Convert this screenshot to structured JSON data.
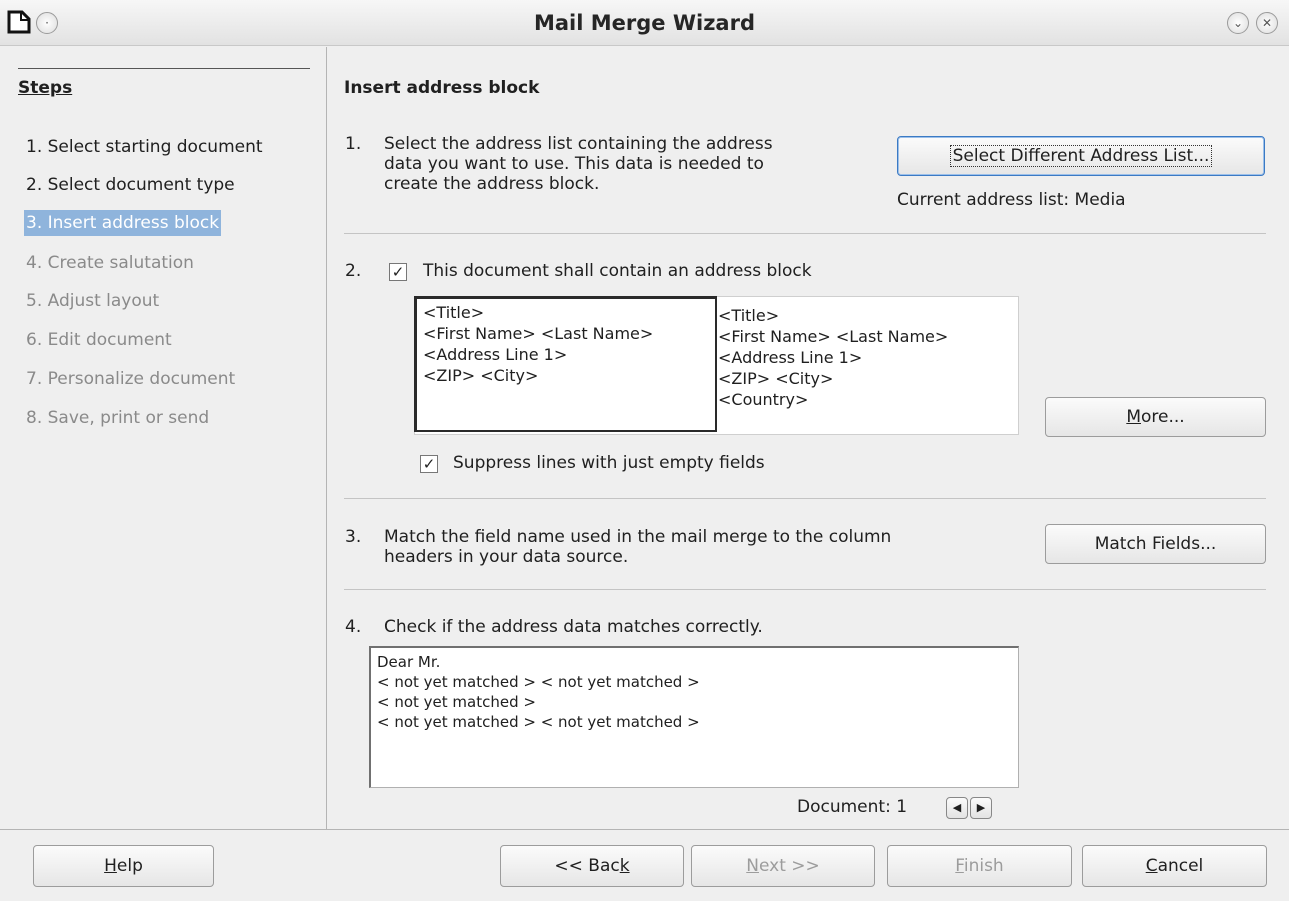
{
  "window": {
    "title": "Mail Merge Wizard"
  },
  "steps": {
    "heading": "Steps",
    "items": [
      {
        "label": "1. Select starting document",
        "state": "enabled"
      },
      {
        "label": "2. Select document type",
        "state": "enabled"
      },
      {
        "label": "3. Insert address block",
        "state": "current"
      },
      {
        "label": "4. Create salutation",
        "state": "disabled"
      },
      {
        "label": "5. Adjust layout",
        "state": "disabled"
      },
      {
        "label": "6. Edit document",
        "state": "disabled"
      },
      {
        "label": "7. Personalize document",
        "state": "disabled"
      },
      {
        "label": "8. Save, print or send",
        "state": "disabled"
      }
    ]
  },
  "main": {
    "heading": "Insert address block",
    "section1": {
      "number": "1.",
      "text_lines": [
        "Select the address list containing the address",
        "data you want to use. This data is needed to",
        "create the address block."
      ],
      "button_label": "Select Different Address List...",
      "current_list": "Current address list: Media"
    },
    "section2": {
      "number": "2.",
      "checkbox_label": "This document shall contain an address block",
      "checkbox_checked": true,
      "block1_lines": [
        "<Title>",
        "<First Name> <Last Name>",
        "<Address Line 1>",
        "<ZIP> <City>"
      ],
      "block2_lines": [
        "<Title>",
        "<First Name> <Last Name>",
        "<Address Line 1>",
        "<ZIP> <City>",
        "<Country>"
      ],
      "more_button": "More...",
      "suppress_label": "Suppress lines with just empty fields",
      "suppress_checked": true
    },
    "section3": {
      "number": "3.",
      "text_lines": [
        "Match the field name used in the mail merge to the column",
        "headers in your data source."
      ],
      "button_label": "Match Fields..."
    },
    "section4": {
      "number": "4.",
      "text": "Check if the address data matches correctly.",
      "preview_lines": [
        "Dear Mr.",
        "< not yet matched > < not yet matched >",
        "< not yet matched >",
        "< not yet matched > < not yet matched >"
      ],
      "document_label": "Document: 1"
    }
  },
  "footer": {
    "help": "Help",
    "back": "<< Back",
    "next": "Next >>",
    "finish": "Finish",
    "cancel": "Cancel"
  }
}
